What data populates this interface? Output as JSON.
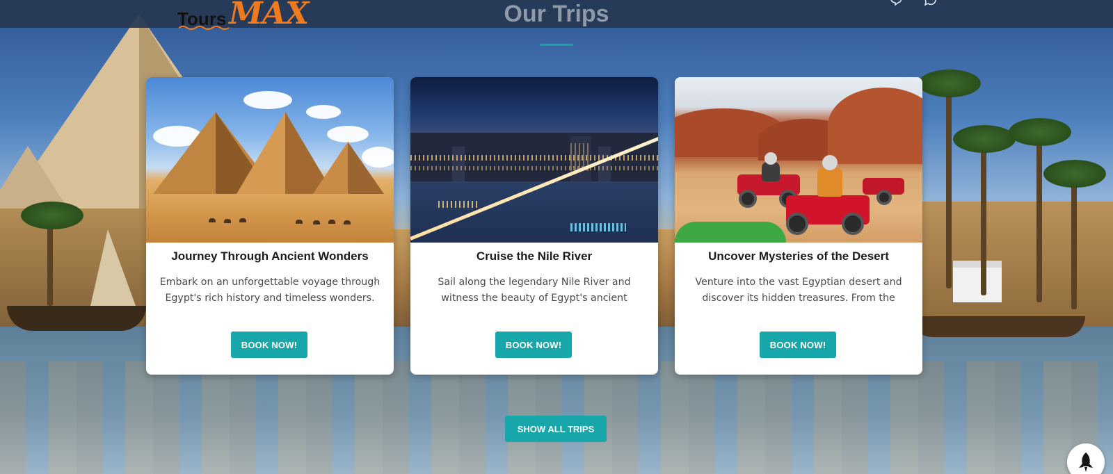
{
  "header": {
    "logo": {
      "part1": "Tours",
      "part2": "MAX"
    },
    "icons": [
      "message-icon",
      "whatsapp-icon"
    ]
  },
  "section": {
    "title": "Our Trips"
  },
  "trips": [
    {
      "title": "Journey Through Ancient Wonders",
      "description": "Embark on an unforgettable voyage through Egypt's rich history and timeless wonders. Ex...",
      "button": "BOOK NOW!",
      "image": "pyramids-photo"
    },
    {
      "title": "Cruise the Nile River",
      "description": "Sail along the legendary Nile River and witness the beauty of Egypt's ancient civilizat...",
      "button": "BOOK NOW!",
      "image": "nile-night-photo"
    },
    {
      "title": "Uncover Mysteries of the Desert",
      "description": "Venture into the vast Egyptian desert and discover its hidden treasures. From the other...",
      "button": "BOOK NOW!",
      "image": "desert-quad-photo"
    }
  ],
  "actions": {
    "show_all": "SHOW ALL TRIPS",
    "scroll_top_icon": "rocket-icon"
  },
  "colors": {
    "accent": "#17a7aa",
    "header_bg": "#263854",
    "logo_orange": "#f07a1e",
    "title_gray": "#8f9aa8"
  }
}
